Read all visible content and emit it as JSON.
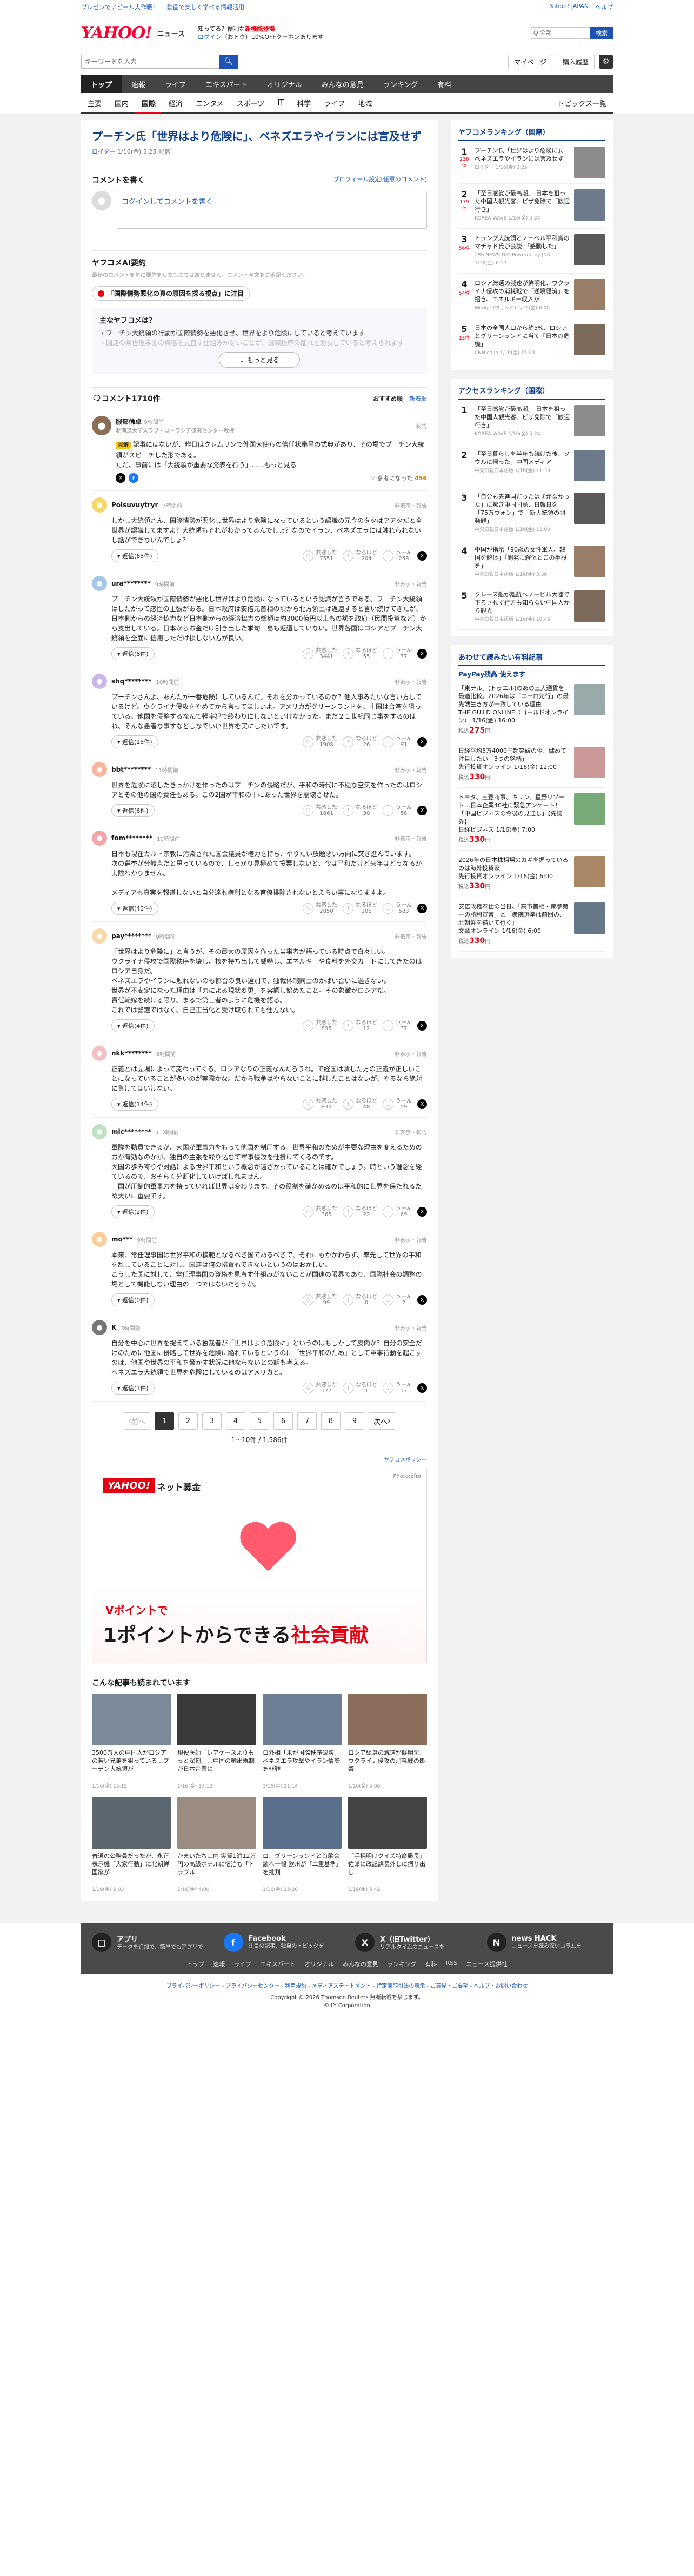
{
  "promo": {
    "left1": "プレゼンでアピール大作戦！",
    "left2": "動画で楽しく学べる情報活用",
    "right": [
      "Yahoo! JAPAN",
      "ヘルプ"
    ]
  },
  "header": {
    "logo": "YAHOO!",
    "logo_sub": "ニュース",
    "promo_line1": "知ってる？便利な",
    "promo_line1_red": "新機能登場",
    "promo_line2": "ログイン",
    "promo_line2_rest": "（おトク）10%OFFクーポンあります",
    "mini_search_placeholder": "Q 全部",
    "mini_search_btn": "検索"
  },
  "search": {
    "placeholder": "キーワードを入力",
    "mypage": "マイページ",
    "purchase": "購入履歴"
  },
  "gnav": [
    "トップ",
    "速報",
    "ライブ",
    "エキスパート",
    "オリジナル",
    "みんなの意見",
    "ランキング",
    "有料"
  ],
  "subnav": [
    "主要",
    "国内",
    "国際",
    "経済",
    "エンタメ",
    "スポーツ",
    "IT",
    "科学",
    "ライフ",
    "地域"
  ],
  "subnav_topics": "トピックス一覧",
  "article": {
    "title": "プーチン氏「世界はより危険に」、ベネズエラやイランには言及せず",
    "source": "ロイター",
    "date": "1/16(金) 3:25 配信"
  },
  "comment_form": {
    "heading": "コメントを書く",
    "profile_link": "プロフィール設定(任意のコメント)",
    "placeholder": "ログインしてコメントを書く"
  },
  "ai": {
    "title": "ヤフコメAI要約",
    "note": "最新のコメントを基に要約をしたものではありません。コメント全文をご確認ください。",
    "pill": "「国際情勢悪化の真の原因を探る視点」に注目",
    "summary_head": "主なヤフコメは？",
    "points": [
      "プーチン大統領の行動が国際情勢を悪化させ、世界をより危険にしていると考えています",
      "国連の常任理事国の資格を見直す仕組みがないことが、国際秩序の乱れを助長していると考えられます"
    ],
    "more": "もっと見る"
  },
  "comments_header": {
    "label": "コメント",
    "count": "1710件",
    "sort": [
      "おすすめ順",
      "新着順"
    ]
  },
  "expert": {
    "name": "服部倫卓",
    "role": "北海道大学スラブ・ユーラシア研究センター教授",
    "time": "9時間前",
    "badge": "見解",
    "body": "記事にはないが、昨日はクレムリンで外国大使らの信任状奉呈の式典があり、その場でプーチン大統領がスピーチした形である。\nただ、事前には「大統領が重要な発表を行う」......もっと見る",
    "helpful": "参考になった",
    "helpful_count": "456",
    "report": "報告"
  },
  "comments": [
    {
      "name": "Poisuvuytryr",
      "time": "7時間前",
      "body": "しかし大統領さん、国際情勢が悪化し世界はより危険になっているという認識の元今のタタはアアタだと全世界が認識してますよ？大統領もそれがわかってるんでしょ？なのでイラン、ベネズエラには触れられないし話ができないんでしょ？",
      "reply": "返信(65件)",
      "likes": "7551",
      "meh": "204",
      "dislike": "258"
    },
    {
      "name": "ura********",
      "time": "9時間前",
      "body": "プーチン大統領が国際情勢が悪化し世界はより危険になっているという認識が言うである。プーチン大統領はしたがって感性の主張がある。日本政府は安倍元首相の頃から北方領土は返還すると言い続けてきたが、日本側からの経済協力など日本側からの経済協力の総額は約3000億円以上もの額を政府（民間投資など）から支出している。日本からお金だけ引き出した挙句一島も返還していない。世界各国はロシアとプーチン大統領を全面に信用しただけ損しない方が良い。",
      "reply": "返信(8件)",
      "likes": "3441",
      "meh": "55",
      "dislike": "77"
    },
    {
      "name": "shq********",
      "time": "10時間前",
      "body": "プーチンさんよ、あんたが一番危険にしているんだ。それを分かっているのか？他人事みたいな言い方しているけど。ウクライナ侵攻をやめてから言ってほしいよ。アメリカがグリーンランドを、中国は台湾を狙っている。他国を侵略するなんて軽率犯で終わりにしないといけなかった。まだ２１世紀同じ事をするのはね、そんな愚者な事すなどしなでいい世界を実にしたいです。",
      "reply": "返信(15件)",
      "likes": "1908",
      "meh": "26",
      "dislike": "91"
    },
    {
      "name": "bbt********",
      "time": "11時間前",
      "body": "世界を危険に晒したきっかけを作ったのはプーチンの侵略だが、平和の時代に不穏な空気を作ったのはロシアとその他の国の責任もある。この2国が平和の中にあった世界を崩壊させた。",
      "reply": "返信(6件)",
      "likes": "1861",
      "meh": "30",
      "dislike": "58"
    },
    {
      "name": "fom********",
      "time": "10時間前",
      "body": "日本も現在カルト宗教に汚染された国会議員が権力を持ち、やりたい放題悪い方向に突き進んでいます。\n次の選挙が分岐点だと思っているので、しっかり見極めて投票しないと、今は平和だけど来年はどうなるか実際わかりません。\n\nメディアも真実を報道しないと自分達も権利となる官僚排除されないとえらい事になりますよ。",
      "reply": "返信(43件)",
      "likes": "2850",
      "meh": "106",
      "dislike": "583"
    },
    {
      "name": "pay********",
      "time": "9時間前",
      "body": "「世界はより危険に」と言うが、その最大の原因を作った当事者が語っている時点で白々しい。\nウクライナ侵攻で国際秩序を壊し、核を持ち出して威嚇し、エネルギーや食料を外交カードにしてきたのはロシア自身だ。\nベネズエラやイランに触れないのも都合の良い選別で、独裁体制同士のかばい合いに過ぎない。\n世界が不安定になった理由は「力による現状変更」を容認し始めたこと。その象徴がロシアだ。\n責任転嫁を続ける限り、まるで第三者のように危機を語る。\nこれでは警鐘ではなく、自己正当化と受け取られても仕方ない。",
      "reply": "返信(4件)",
      "likes": "895",
      "meh": "12",
      "dislike": "37"
    },
    {
      "name": "nkk********",
      "time": "8時間前",
      "body": "正義とは立場によって変わってくる。ロシアなりの正義なんだろうね。で経国は潰した方の正義が正しいことになっていることが多いのが実際かな。だから戦争はやらないことに越したことはないが、やるなら絶対に負けてはいけない。",
      "reply": "返信(14件)",
      "likes": "830",
      "meh": "48",
      "dislike": "59"
    },
    {
      "name": "mic********",
      "time": "11時間前",
      "body": "軍隊を動員できるが、大国が軍事力をもって他国を制圧する。世界平和のためが主要な理由を変えるための方が有効なのかが、独自の主張を繰り込むて軍事侵攻を仕掛けてくるのです。\n大国の歩み寄りや対話による世界平和という概念が遠ざかっていることは確かでしょう。時という理念を経ているので、おそらく分断化していけばしれません。\n一国が圧倒的軍事力を持っていれば世界は変わります。その役割を確かめるのは平和的に世界を保たれるため大いに重要です。",
      "reply": "返信(2件)",
      "likes": "365",
      "meh": "22",
      "dislike": "69"
    },
    {
      "name": "mo***",
      "time": "9時間前",
      "body": "本来、常任理事国は世界平和の模範となるべき国であるべきで、それにもかかわらず、率先して世界の平和を乱していることに対し、国連は何の措置もできないというのはおかしい。\nこうした国に対して、常任理事国の資格を見直す仕組みがないことが国連の限界であり、国際社会の調整の場として機能しない理由の一つではないだろうか。",
      "reply": "返信(0件)",
      "likes": "99",
      "meh": "0",
      "dislike": "2"
    },
    {
      "name": "K",
      "time": "3時間前",
      "body": "自分を中心に世界を捉えている独裁者が「世界はより危険に」というのはもしかして皮肉か？自分の安全だけのために他国に侵略して世界を危険に陥れているというのに「世界平和のため」として軍事行動を起こすのは、他国や世界の平和を脅かす状況に他ならないとの話も考える。\nベネズエラ大統領で世界を危険にしているのはアメリカと。",
      "reply": "返信(1件)",
      "likes": "177",
      "meh": "1",
      "dislike": "17"
    }
  ],
  "react_labels": {
    "likes": "共感した",
    "meh": "なるほど",
    "dislike": "うーん"
  },
  "report_label": "非表示・報告",
  "pager": {
    "prev": "前へ",
    "pages": [
      "1",
      "2",
      "3",
      "4",
      "5",
      "6",
      "7",
      "8",
      "9"
    ],
    "next": "次へ",
    "info": "1～10件 / 1,586件"
  },
  "ad": {
    "credit_link": "ヤフコメポリシー",
    "logo": "YAHOO!",
    "logo_text": "ネット募金",
    "image_credit": "Photo:afro",
    "point_line": "Vポイントで",
    "headline_a": "1ポイントからできる",
    "headline_b": "社会貢献"
  },
  "reads": {
    "title": "こんな記事も読まれています",
    "items": [
      {
        "t": "3500万人の中国人がロシアの若い兄弟を狙っている…プーチン大統領が",
        "src": "1/16(金) 15:15"
      },
      {
        "t": "現役医師「レアケースよりもっと深刻」…中国の輸出規制が日本企業に",
        "src": "1/16(金) 17:12"
      },
      {
        "t": "ロ外相「米が国際秩序破壊」 ベネズエラ攻撃やイラン情勢を非難",
        "src": "1/16(金) 11:14"
      },
      {
        "t": "ロシア総選の減速が鮮明化、ウクライナ侵攻の消耗戦の影響",
        "src": "1/16(金) 5:00"
      },
      {
        "t": "普通の公務員だったが、永正表示機「大家行動」に北朝鮮国家が",
        "src": "1/16(金) 6:03"
      },
      {
        "t": "かまいたち山内 実質1泊12万円の高級ホテルに宿泊も「トラブル",
        "src": "1/16(金) 4:00"
      },
      {
        "t": "ロ、グリーンランドと首脳会談へ一報 欧州が「二重基準」を批判",
        "src": "1/16(金) 15:30"
      },
      {
        "t": "「手柄明けクイズ特命局長」佐郎に政記課長外しに振り出し",
        "src": "1/16(金) 5:42"
      }
    ]
  },
  "side_ranking": {
    "title": "ヤフコメランキング（国際）",
    "items": [
      {
        "n": "1",
        "c": "236件",
        "t": "プーチン氏「世界はより危険に」、ベネズエラやイランには言及せず",
        "src": "ロイター 1/16(金) 3:25"
      },
      {
        "n": "2",
        "c": "179件",
        "t": "「至日感覚が最高潮」 日本を狙った中国人観光客、ビザ免除で「歓迎行き」",
        "src": "KOREA WAVE 1/16(金) 5:24"
      },
      {
        "n": "3",
        "c": "56件",
        "t": "トランプ大統領とノーベル平和賞のマチャド氏が会談 「感動した」",
        "src": "TBS NEWS DIG Powered by JNN 1/16(金) 6:17"
      },
      {
        "n": "4",
        "c": "54件",
        "t": "ロシア総選の減速が鮮明化、ウクライナ侵攻の消耗戦で「逆境経済」を招き、エネルギー収入が",
        "src": "Wedge (ウェッジ) 1/16(金) 6:00"
      },
      {
        "n": "5",
        "c": "13件",
        "t": "日本の全国人口から約5%、ロシアとグリーンランドに当て「日本の危機」",
        "src": "CNN.co.jp 1/16(金) 15:23"
      }
    ]
  },
  "side_access": {
    "title": "アクセスランキング（国際）",
    "items": [
      {
        "n": "1",
        "t": "「至日感覚が最高潮」 日本を狙った中国人観光客、ビザ免除で「歓迎行き」",
        "src": "KOREA WAVE 1/16(金) 5:24"
      },
      {
        "n": "2",
        "t": "「至日暮らしを半年も続けた後、ソウルに帰った」中国メディア",
        "src": "中央日報日本語版 1/16(金) 11:33"
      },
      {
        "n": "3",
        "t": "「自分も先進国だったはずがなかった」に驚き中国国民、日韓日を「75万ウォン」で「新大統領の開発観」",
        "src": "中央日報日本語版 1/16(金) 13:00"
      },
      {
        "n": "4",
        "t": "中国が指示「90歳の女性軍人、韓国を解体」「開発に解体とこの手段を」",
        "src": "中央日報日本語版 1/16(金) 5:30"
      },
      {
        "n": "5",
        "t": "クレーズ船が離航へノービル大陸で下ろされず行方も知らない中国人から観光",
        "src": "中央日報日本語版 1/16(金) 18:45"
      }
    ]
  },
  "side_pp": {
    "title": "あわせて読みたい有料記事",
    "sub": "PayPay残高 使えます",
    "items": [
      {
        "t": "「東チル」(トゥエル)のあの三大通貨を最適比較。2026年は「ユーロ先行」の最先端生き方が一致している理由",
        "src": "THE GUILD ONLINE（ゴールドオンライン） 1/16(金) 16:00",
        "price": "275"
      },
      {
        "t": "日経平均5万4000円超突破の今、儲めて注目したい「3つの銘柄」",
        "src": "先行投資オンライン 1/16(金) 12:00",
        "price": "330"
      },
      {
        "t": "トヨタ、三菱商事、キリン、星野リゾート…日本企業40社に緊急アンケート！「中国ビジネスの今後の見通し」【先読み】",
        "src": "日経ビジネス 1/16(金) 7:00",
        "price": "330"
      },
      {
        "t": "2026年の日本株相場のカギを握っているのは海外投資家",
        "src": "先行投資オンライン 1/16(金) 6:00",
        "price": "330"
      },
      {
        "t": "安倍政権奉仕の当日、「高市首相・衆参第一の勝利宣言」と「衆院選挙は前回の、北朝鮮を描いて行く」",
        "src": "文藝オンライン 1/16(金) 6:00",
        "price": "330"
      }
    ]
  },
  "footer": {
    "cols": [
      {
        "t": "アプリ",
        "d": "データを追加で、簡単でもアプリで"
      },
      {
        "t": "Facebook",
        "d": "注目の記事、独自のトピックを"
      },
      {
        "t": "X（旧Twitter）",
        "d": "リアルタイムのニュースを"
      },
      {
        "t": "news HACK",
        "d": "ニュースを読み深いコラムを"
      }
    ],
    "links": [
      "トップ",
      "速報",
      "ライブ",
      "エキスパート",
      "オリジナル",
      "みんなの意見",
      "ランキング",
      "有料",
      "RSS",
      "ニュース提供社"
    ],
    "bottom": "プライバシーポリシー - プライバシーセンター - 利用規約 - メディアステートメント - 特定商取引法の表示 - ご意見・ご要望 - ヘルプ・お問い合わせ",
    "copyright": "Copyright © 2026 Thomson Reuters 無断転載を禁じます。",
    "copyright2": "© LY Corporation"
  }
}
